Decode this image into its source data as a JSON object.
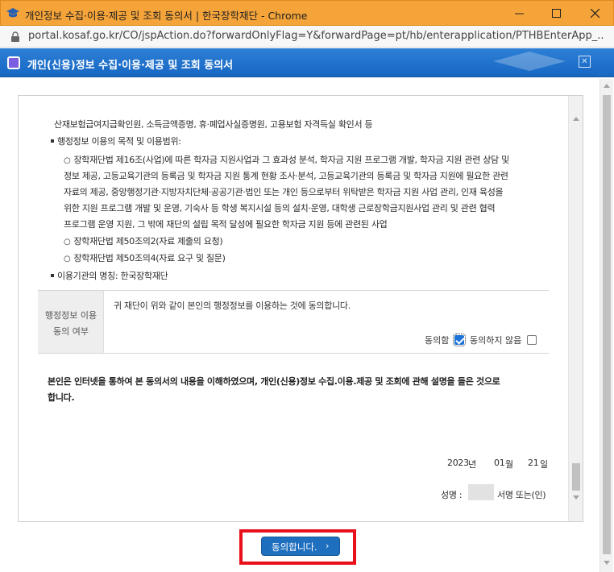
{
  "window": {
    "title": "개인정보 수집·이용·제공 및 조회 동의서 | 한국장학재단 - Chrome",
    "url": "portal.kosaf.go.kr/CO/jspAction.do?forwardOnlyFlag=Y&forwardPage=pt/hb/enterapplication/PTHBEnterApp_..."
  },
  "popup": {
    "title": "개인(신용)정보 수집·이용·제공 및 조회 동의서"
  },
  "content": {
    "line_top": "산재보험급여지급확인원, 소득금액증명, 휴·폐업사실증명원, 고용보험 자격득실 확인서 등",
    "purpose_heading": "행정정보 이용의 목적 및 이용범위:",
    "purpose_lines": [
      "장학재단법 제16조(사업)에 따른 학자금 지원사업과 그 효과성 분석, 학자금 지원 프로그램 개발, 학자금 지원 관련 상담 및",
      "정보 제공, 고등교육기관의 등록금 및 학자금 지원 통계 현황 조사·분석, 고등교육기관의 등록금 및 학자금 지원에 필요한 관련",
      "자료의 제공, 중앙행정기관·지방자치단체·공공기관·법인 또는 개인 등으로부터 위탁받은 학자금 지원 사업 관리, 인재 육성을",
      "위한 지원 프로그램 개발 및 운영, 기숙사 등 학생 복지시설 등의 설치·운영, 대학생 근로장학금지원사업 관리 및 관련 협력",
      "프로그램 운영 지원, 그 밖에 재단의 설립 목적 달성에 필요한 학자금 지원 등에 관련된 사업"
    ],
    "law_items": [
      "장학재단법 제50조의2(자료 제출의 요청)",
      "장학재단법 제50조의4(자료 요구 및 질문)"
    ],
    "agency": "이용기관의 명칭: 한국장학재단"
  },
  "consent": {
    "header_line1": "행정정보 이용",
    "header_line2": "동의 여부",
    "text": "귀 재단이 위와 같이 본인의 행정정보를 이용하는 것에 동의합니다.",
    "agree_label": "동의함",
    "disagree_label": "동의하지 않음",
    "agree_checked": true,
    "disagree_checked": false
  },
  "statement": {
    "line1": "본인은 인터넷을 통하여 본 동의서의 내용을 이해하였으며, 개인(신용)정보 수집.이용.제공 및 조회에 관해 설명을 들은 것으로",
    "line2": "합니다."
  },
  "date": {
    "year": "2023",
    "year_unit": "년",
    "month": "01",
    "month_unit": "월",
    "day": "21",
    "day_unit": "일"
  },
  "signature": {
    "label": "성명 :",
    "suffix": "서명 또는(인)"
  },
  "agree_button": {
    "label": "동의합니다.",
    "chevron": "›"
  },
  "colors": {
    "titlebar": "#f5a43a",
    "popup_header": "#1868c4",
    "button": "#1f6fbf",
    "highlight_box": "#e8101a"
  }
}
